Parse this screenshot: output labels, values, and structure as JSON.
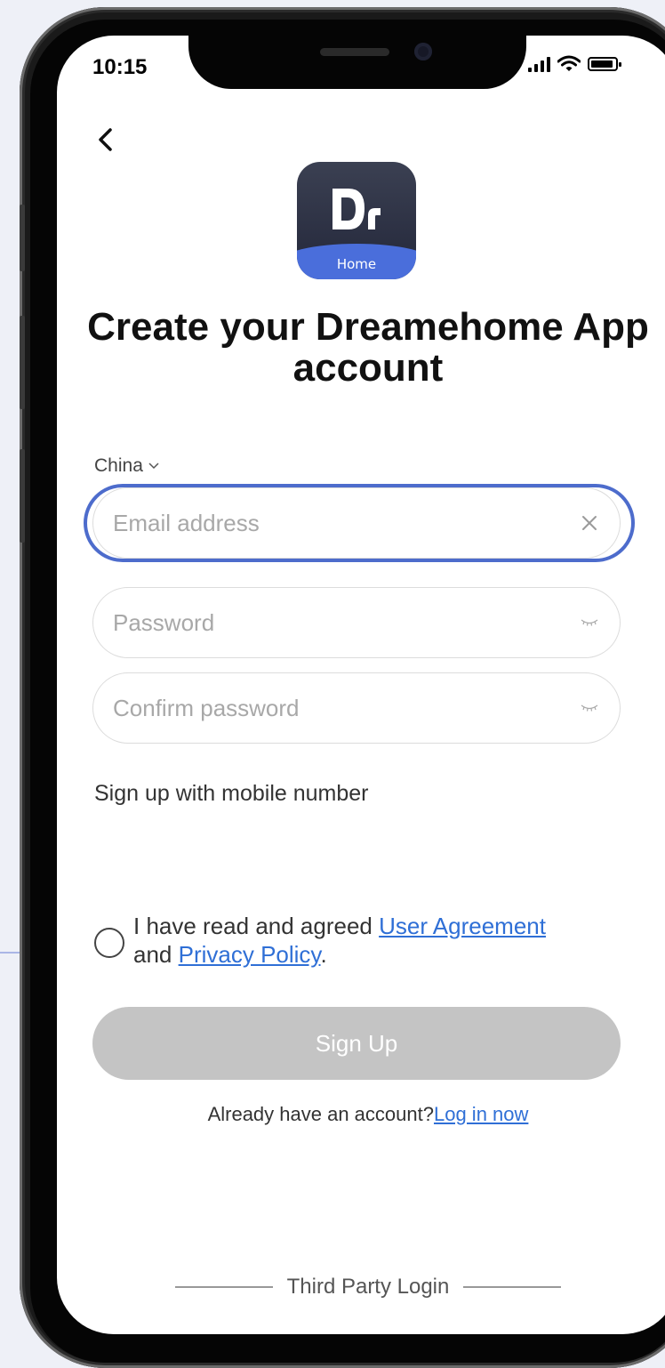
{
  "status_bar": {
    "time": "10:15"
  },
  "logo": {
    "word": "Home"
  },
  "title": "Create your Dreamehome App account",
  "region": {
    "label": "China"
  },
  "fields": {
    "email": {
      "placeholder": "Email address"
    },
    "password": {
      "placeholder": "Password"
    },
    "confirm": {
      "placeholder": "Confirm password"
    }
  },
  "mobile_signup_label": "Sign up with mobile number",
  "agreement": {
    "prefix": "I have read and agreed ",
    "user_agreement": "User Agreement",
    "middle": " and ",
    "privacy_policy": "Privacy Policy",
    "suffix": "."
  },
  "signup_button": "Sign Up",
  "login": {
    "prompt": "Already have an account?",
    "link": "Log in now"
  },
  "third_party_label": "Third Party Login",
  "colors": {
    "accent": "#2f6fd6",
    "highlight": "#4d6ccc",
    "button_disabled": "#c4c4c4"
  }
}
